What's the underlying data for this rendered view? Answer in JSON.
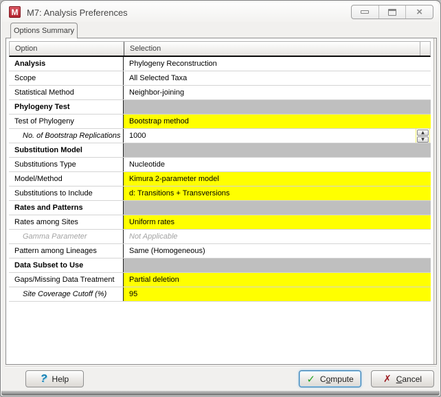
{
  "window": {
    "title": "M7: Analysis Preferences",
    "icon_letter": "M"
  },
  "tabs": [
    {
      "label": "Options Summary",
      "active": true
    }
  ],
  "table": {
    "columns": {
      "option": "Option",
      "selection": "Selection"
    },
    "rows": [
      {
        "option": "Analysis",
        "selection": "Phylogeny Reconstruction",
        "kind": "bold"
      },
      {
        "option": "Scope",
        "selection": "All Selected Taxa",
        "kind": "normal"
      },
      {
        "option": "Statistical Method",
        "selection": "Neighbor-joining",
        "kind": "normal"
      },
      {
        "option": "Phylogeny Test",
        "selection": "",
        "kind": "section"
      },
      {
        "option": "Test of Phylogeny",
        "selection": "Bootstrap method",
        "kind": "normal",
        "highlight": true
      },
      {
        "option": "No. of Bootstrap Replications",
        "selection": "1000",
        "kind": "sub",
        "spinner": true
      },
      {
        "option": "Substitution Model",
        "selection": "",
        "kind": "section"
      },
      {
        "option": "Substitutions Type",
        "selection": "Nucleotide",
        "kind": "normal"
      },
      {
        "option": "Model/Method",
        "selection": "Kimura 2-parameter model",
        "kind": "normal",
        "highlight": true
      },
      {
        "option": "Substitutions to Include",
        "selection": "d: Transitions + Transversions",
        "kind": "normal",
        "highlight": true
      },
      {
        "option": "Rates and Patterns",
        "selection": "",
        "kind": "section"
      },
      {
        "option": "Rates among Sites",
        "selection": "Uniform rates",
        "kind": "normal",
        "highlight": true
      },
      {
        "option": "Gamma Parameter",
        "selection": "Not Applicable",
        "kind": "disabled"
      },
      {
        "option": "Pattern among Lineages",
        "selection": "Same (Homogeneous)",
        "kind": "normal"
      },
      {
        "option": "Data Subset to Use",
        "selection": "",
        "kind": "section"
      },
      {
        "option": "Gaps/Missing Data Treatment",
        "selection": "Partial deletion",
        "kind": "normal",
        "highlight": true
      },
      {
        "option": "Site Coverage Cutoff (%)",
        "selection": "95",
        "kind": "sub",
        "highlight": true
      }
    ]
  },
  "footer": {
    "help_label": "Help",
    "compute": {
      "pre": "C",
      "mnemonic": "o",
      "post": "mpute"
    },
    "cancel": {
      "pre": "",
      "mnemonic": "C",
      "post": "ancel"
    }
  },
  "icons": {
    "help": "?",
    "compute_check": "✓",
    "cancel_x": "✗",
    "close": "×",
    "spinner_up": "▲",
    "spinner_down": "▼"
  },
  "colors": {
    "highlight_yellow": "#ffff00",
    "section_gray": "#bfbfbf",
    "mega_icon_red": "#b2222d",
    "compute_green": "#22a322",
    "cancel_red": "#9c1a20",
    "help_blue": "#1580b4"
  }
}
